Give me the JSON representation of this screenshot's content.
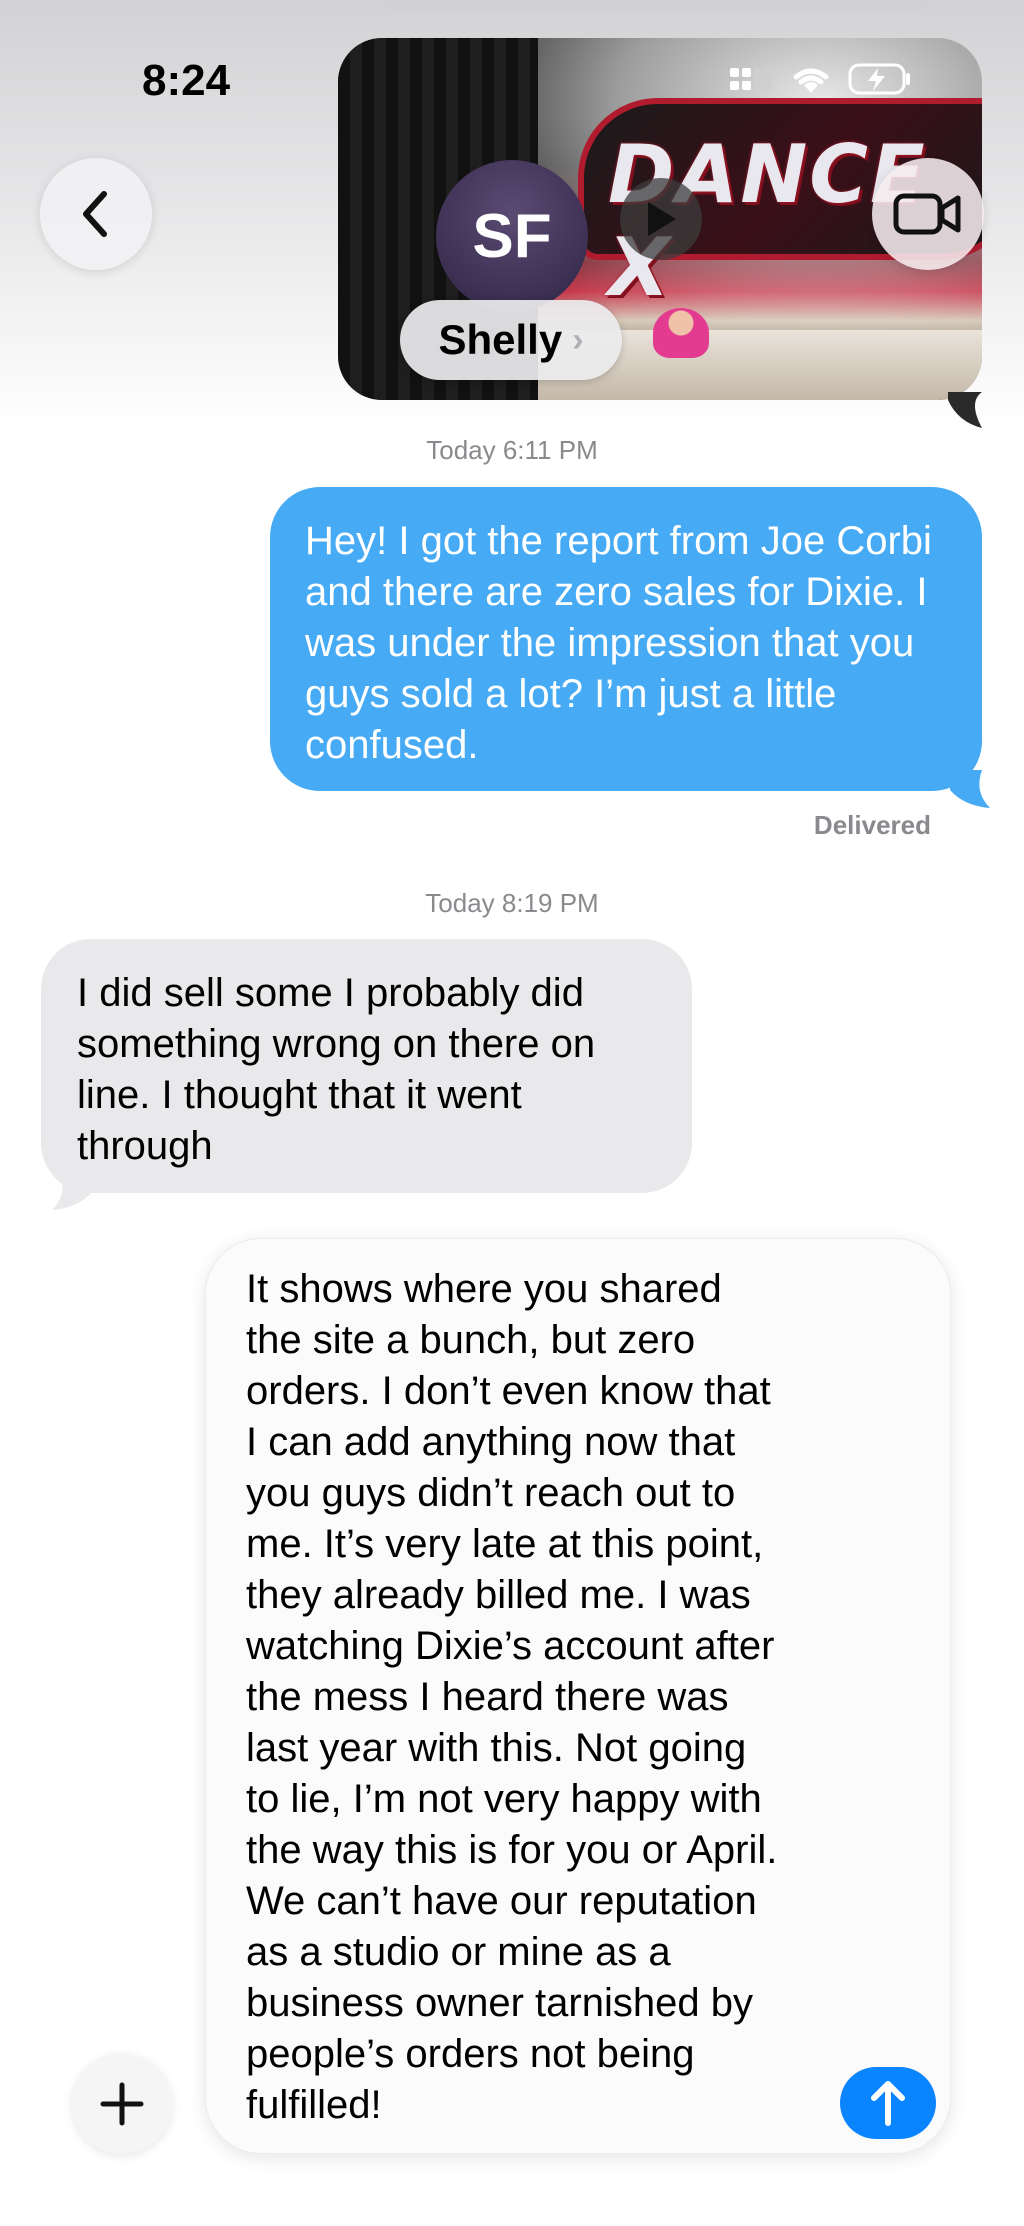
{
  "status_bar": {
    "time": "8:24",
    "icons": [
      "signal-icon",
      "wifi-icon",
      "battery-charging-icon"
    ]
  },
  "header": {
    "avatar_initials": "SF",
    "contact_name": "Shelly",
    "contact_chevron": "›",
    "back_icon": "chevron-left-icon",
    "video_call_icon": "video-camera-icon"
  },
  "thread": {
    "video_thumbnail": {
      "banner_text": "DANCE X",
      "play_icon": "play-icon"
    },
    "timestamp_1": "Today 6:11 PM",
    "sent_message": "Hey! I got the report from Joe Corbi and there are zero sales for Dixie. I was under the impression that you guys sold a lot? I’m just a little confused.",
    "delivered_label": "Delivered",
    "timestamp_2": "Today 8:19 PM",
    "received_message": "I did sell some I probably did something wrong on there on line. I thought that it went through"
  },
  "compose": {
    "add_icon": "plus-icon",
    "draft_text": "It shows where you shared\nthe site a bunch, but zero\norders. I don’t even know that\nI can add anything now that\nyou guys didn’t reach out to\nme. It’s very late at this point,\nthey already billed me. I was\nwatching Dixie’s account after\nthe mess I heard there was\nlast year with this. Not going\nto lie, I’m not very happy with\nthe way this is for you or April.\nWe can’t have our reputation\nas a studio or mine as a\nbusiness owner tarnished by\npeople’s orders not being\nfulfilled!",
    "send_icon": "arrow-up-icon"
  },
  "colors": {
    "sent_bubble": "#46aaf5",
    "received_bubble": "#e9e9eb",
    "send_button": "#0a84ff",
    "avatar_bg": "#3b2f52",
    "timestamp_text": "#8a8a8e"
  }
}
